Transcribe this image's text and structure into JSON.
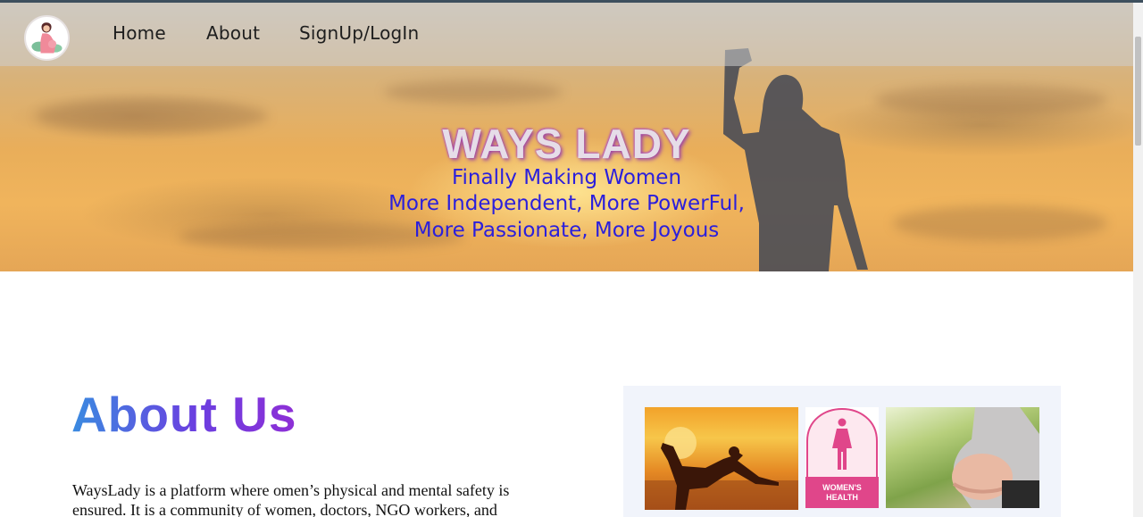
{
  "nav": {
    "logo_icon": "pregnant-woman-logo-icon",
    "links": [
      {
        "label": "Home"
      },
      {
        "label": "About"
      },
      {
        "label": "SignUp/LogIn"
      }
    ]
  },
  "hero": {
    "title": "WAYS LADY",
    "tagline": [
      "Finally Making Women",
      "More Independent, More PowerFul,",
      "More Passionate, More Joyous"
    ]
  },
  "about": {
    "heading": "About Us",
    "lines": [
      "WaysLady is a platform where omen’s physical and mental safety is",
      "ensured. It is a community of women, doctors, NGO workers, and"
    ],
    "gallery": {
      "tiles": [
        "yoga-silhouette-image",
        "womens-health-image",
        "pregnancy-image"
      ],
      "health_label_line1": "WOMEN'S",
      "health_label_line2": "HEALTH"
    }
  },
  "colors": {
    "tagline": "#2b1fdc",
    "heading_gradient_start": "#3a8be0",
    "heading_gradient_end": "#8e2fd6",
    "health_pink": "#e0468a"
  }
}
